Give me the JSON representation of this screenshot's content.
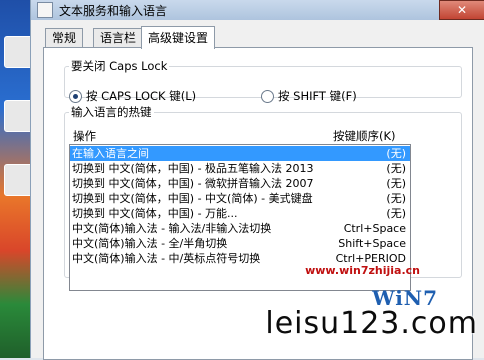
{
  "window": {
    "title": "文本服务和输入语言",
    "close_label": "✕"
  },
  "tabs": [
    "常规",
    "语言栏",
    "高级键设置"
  ],
  "caps_lock": {
    "legend": "要关闭 Caps Lock",
    "option_caps": "按 CAPS LOCK 键(L)",
    "option_shift": "按 SHIFT 键(F)",
    "selected": "caps"
  },
  "hotkeys": {
    "legend": "输入语言的热键",
    "col_action": "操作",
    "col_keys": "按键顺序(K)",
    "rows": [
      {
        "action": "在输入语言之间",
        "keys": "(无)"
      },
      {
        "action": "切换到 中文(简体，中国) - 极品五笔输入法 2013",
        "keys": "(无)"
      },
      {
        "action": "切换到 中文(简体，中国) - 微软拼音输入法 2007",
        "keys": "(无)"
      },
      {
        "action": "切换到 中文(简体，中国) - 中文(简体) - 美式键盘",
        "keys": "(无)"
      },
      {
        "action": "切换到 中文(简体，中国) - 万能...",
        "keys": "(无)"
      },
      {
        "action": "中文(简体)输入法 - 输入法/非输入法切换",
        "keys": "Ctrl+Space"
      },
      {
        "action": "中文(简体)输入法 - 全/半角切换",
        "keys": "Shift+Space"
      },
      {
        "action": "中文(简体)输入法 - 中/英标点符号切换",
        "keys": "Ctrl+PERIOD"
      }
    ],
    "selected_index": 0
  },
  "watermark": {
    "logo": "WiN7",
    "url": "www.win7zhijia.cn",
    "site": "leisu123.com"
  },
  "colors": {
    "selection": "#3399ff",
    "close": "#c24433",
    "accent": "#1f5fb0"
  }
}
